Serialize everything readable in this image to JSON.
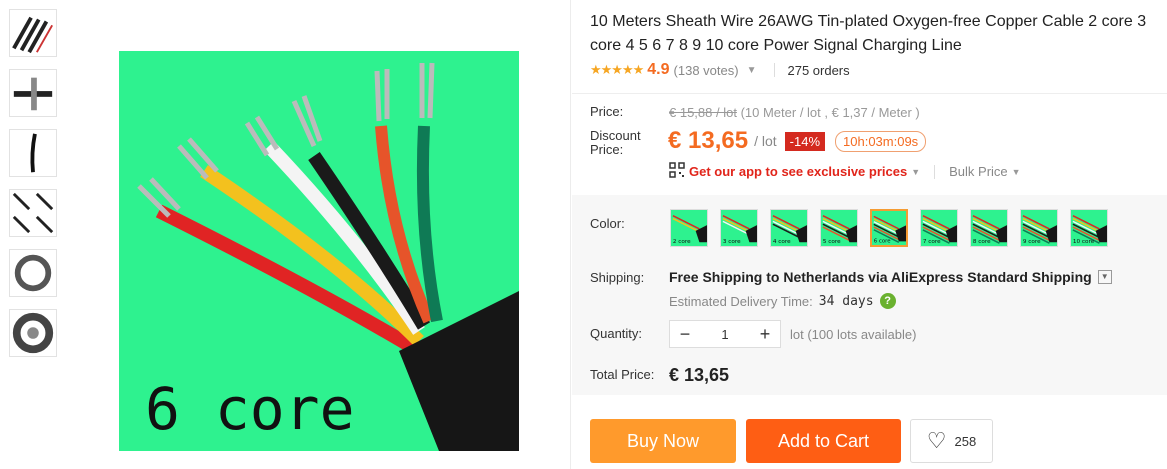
{
  "product": {
    "title": "10 Meters Sheath Wire 26AWG Tin-plated Oxygen-free Copper Cable 2 core 3 core 4 5 6 7 8 9 10 core Power Signal Charging Line",
    "image_caption": "6 core"
  },
  "rating": {
    "stars": "★★★★★",
    "value": "4.9",
    "votes": "(138 votes)",
    "orders": "275 orders"
  },
  "price": {
    "label": "Price:",
    "original": "€ 15,88 / lot",
    "original_detail": "(10 Meter / lot , € 1,37 / Meter )",
    "discount_label": "Discount Price:",
    "current": "€ 13,65",
    "unit": "/ lot",
    "discount_badge": "-14%",
    "timer": "10h:03m:09s",
    "app_link": "Get our app to see exclusive prices",
    "bulk_price": "Bulk Price"
  },
  "color": {
    "label": "Color:",
    "options": [
      "2 core",
      "3 core",
      "4 core",
      "5 core",
      "6 core",
      "7 core",
      "8 core",
      "9 core",
      "10 core"
    ],
    "selected": "6 core",
    "accent": "#f59c33"
  },
  "shipping": {
    "label": "Shipping:",
    "text": "Free Shipping to Netherlands via AliExpress Standard Shipping",
    "eta_label": "Estimated Delivery Time:",
    "eta_value": "34 days",
    "help_glyph": "?"
  },
  "quantity": {
    "label": "Quantity:",
    "value": "1",
    "minus": "−",
    "plus": "+",
    "note": "lot (100 lots available)"
  },
  "total": {
    "label": "Total Price:",
    "value": "€ 13,65"
  },
  "actions": {
    "buy_now": "Buy Now",
    "add_to_cart": "Add to Cart",
    "wishlist_count": "258"
  },
  "colors": {
    "accent_orange": "#f46b21",
    "buy_now_bg": "#ff9a2c",
    "cart_bg": "#fe5e14",
    "image_bg": "#2ef28f"
  }
}
